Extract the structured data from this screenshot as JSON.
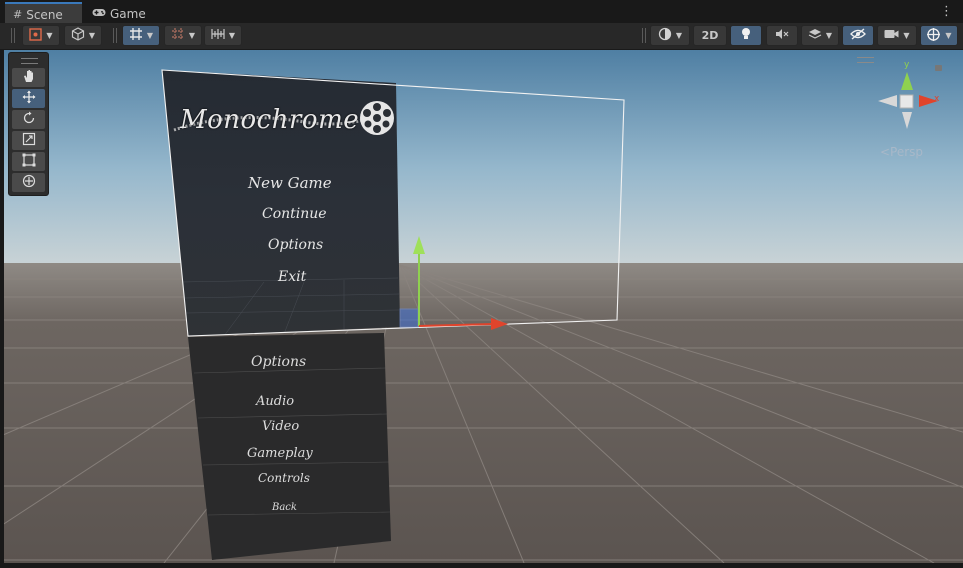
{
  "tabs": [
    {
      "label": "Scene",
      "icon": "hash-icon",
      "active": true
    },
    {
      "label": "Game",
      "icon": "gamepad-icon",
      "active": false
    }
  ],
  "toolbar": {
    "toggle_2d": "2D"
  },
  "gizmo": {
    "y_label": "y",
    "x_label": "x",
    "projection": "<Persp"
  },
  "menu_top": {
    "title": "Monochrome",
    "items": [
      "New Game",
      "Continue",
      "Options",
      "Exit"
    ]
  },
  "menu_bottom": {
    "title": "Options",
    "items": [
      "Audio",
      "Video",
      "Gameplay",
      "Controls",
      "Back"
    ]
  },
  "colors": {
    "accent": "#46607c",
    "tab_highlight": "#3a79bb",
    "axis_x": "#e0442c",
    "axis_y": "#8fd14f",
    "axis_z": "#3d6fd8"
  }
}
